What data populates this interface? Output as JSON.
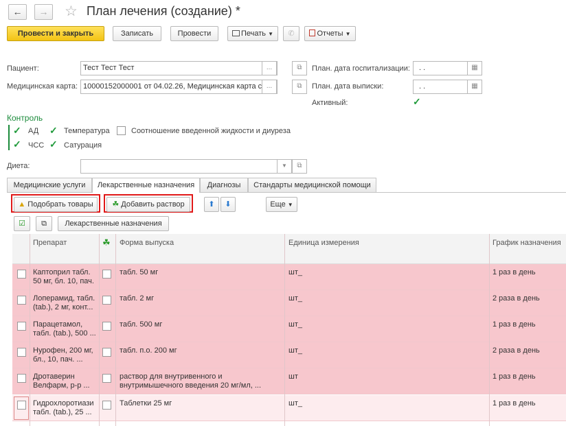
{
  "window": {
    "title": "План лечения (создание) *"
  },
  "toolbar": {
    "post_close": "Провести и закрыть",
    "save": "Записать",
    "post": "Провести",
    "print": "Печать",
    "reports": "Отчеты"
  },
  "form": {
    "patient_label": "Пациент:",
    "patient_value": "Тест Тест Тест",
    "card_label": "Медицинская карта:",
    "card_value": "10000152000001 от 04.02.26, Медицинская карта с",
    "hosp_label": "План. дата госпитализации:",
    "hosp_value": ". .",
    "discharge_label": "План. дата выписки:",
    "discharge_value": ". .",
    "active_label": "Активный:",
    "control_label": "Контроль",
    "control": {
      "ad": "АД",
      "temp": "Температура",
      "ratio": "Соотношение введенной жидкости и диуреза",
      "chss": "ЧСС",
      "sat": "Сатурация"
    },
    "diet_label": "Диета:",
    "diet_value": ""
  },
  "tabs": [
    "Медицинские услуги",
    "Лекарственные назначения",
    "Диагнозы",
    "Стандарты медицинской помощи"
  ],
  "tab_toolbar": {
    "pick": "Подобрать товары",
    "add_solution": "Добавить раствор",
    "more": "Еще",
    "drug_orders": "Лекарственные назначения"
  },
  "table": {
    "columns": [
      "Препарат",
      "Форма выпуска",
      "Единица измерения",
      "График назначения"
    ],
    "rows": [
      {
        "drug": [
          "Каптоприл табл.",
          "50 мг, бл. 10, пач."
        ],
        "form": [
          "табл. 50 мг"
        ],
        "unit": "шт_",
        "schedule": "1 раз в день"
      },
      {
        "drug": [
          "Лоперамид, табл.",
          "(tab.), 2 мг, конт..."
        ],
        "form": [
          "табл. 2 мг"
        ],
        "unit": "шт_",
        "schedule": "2 раза в день"
      },
      {
        "drug": [
          "Парацетамол,",
          "табл. (tab.), 500 ..."
        ],
        "form": [
          "табл. 500 мг"
        ],
        "unit": "шт_",
        "schedule": "1 раз в день"
      },
      {
        "drug": [
          "Нурофен, 200 мг,",
          "бл., 10, пач. ..."
        ],
        "form": [
          "табл. п.о. 200 мг"
        ],
        "unit": "шт_",
        "schedule": "2 раза в день"
      },
      {
        "drug": [
          "Дротаверин",
          "Велфарм, р-р ..."
        ],
        "form": [
          "раствор для внутривенного и",
          "внутримышечного введения 20 мг/мл, ..."
        ],
        "unit": "шт",
        "schedule": "1 раз в день"
      },
      {
        "drug": [
          "Гидрохлоротиази",
          "табл. (tab.), 25 ..."
        ],
        "form": [
          "Таблетки 25 мг"
        ],
        "unit": "шт_",
        "schedule": "1 раз в день"
      }
    ]
  }
}
